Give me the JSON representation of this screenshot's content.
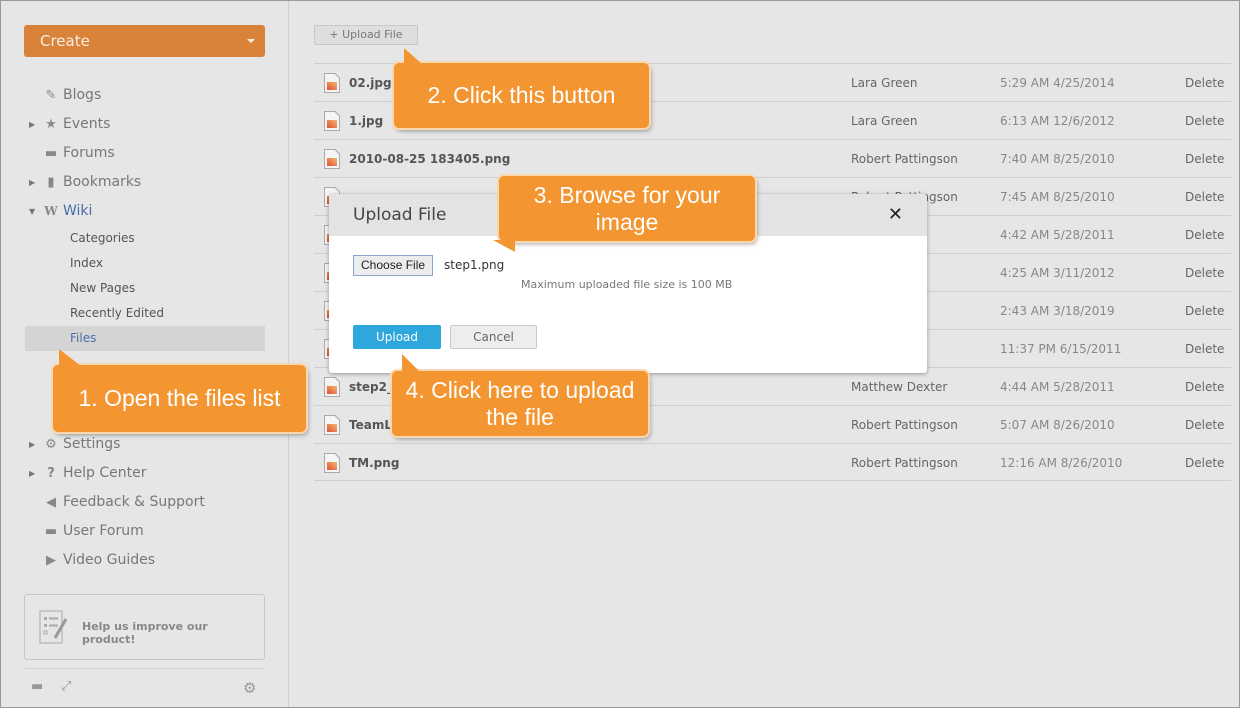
{
  "sidebar": {
    "create_label": "Create",
    "nav": [
      {
        "label": "Blogs",
        "icon": "edit-icon"
      },
      {
        "label": "Events",
        "icon": "pin-icon",
        "expandable": true
      },
      {
        "label": "Forums",
        "icon": "chat-bubble-icon"
      },
      {
        "label": "Bookmarks",
        "icon": "bookmark-icon",
        "expandable": true
      },
      {
        "label": "Wiki",
        "icon": "wiki-icon",
        "expanded": true
      }
    ],
    "wiki_sub": [
      "Categories",
      "Index",
      "New Pages",
      "Recently Edited",
      "Files"
    ],
    "nav_bottom": [
      {
        "label": "Settings",
        "icon": "gear-icon",
        "expandable": true
      },
      {
        "label": "Help Center",
        "icon": "question-icon",
        "expandable": true
      },
      {
        "label": "Feedback & Support",
        "icon": "megaphone-icon"
      },
      {
        "label": "User Forum",
        "icon": "comment-icon"
      },
      {
        "label": "Video Guides",
        "icon": "video-icon"
      }
    ],
    "help_box_label": "Help us improve our product!"
  },
  "main": {
    "upload_button_label": "+ Upload File",
    "files": [
      {
        "name": "02.jpg",
        "user": "Lara Green",
        "date": "5:29 AM 4/25/2014",
        "action": "Delete"
      },
      {
        "name": "1.jpg",
        "user": "Lara Green",
        "date": "6:13 AM 12/6/2012",
        "action": "Delete"
      },
      {
        "name": "2010-08-25 183405.png",
        "user": "Robert Pattingson",
        "date": "7:40 AM 8/25/2010",
        "action": "Delete"
      },
      {
        "name": "",
        "user": "Robert Pattingson",
        "date": "7:45 AM 8/25/2010",
        "action": "Delete"
      },
      {
        "name": "",
        "user": "",
        "date": "4:42 AM 5/28/2011",
        "action": "Delete"
      },
      {
        "name": "",
        "user": "",
        "date": "4:25 AM 3/11/2012",
        "action": "Delete"
      },
      {
        "name": "",
        "user": "",
        "date": "2:43 AM 3/18/2019",
        "action": "Delete"
      },
      {
        "name": "",
        "user": "",
        "date": "11:37 PM 6/15/2011",
        "action": "Delete"
      },
      {
        "name": "step2_",
        "user": "Matthew Dexter",
        "date": "4:44 AM 5/28/2011",
        "action": "Delete"
      },
      {
        "name": "TeamL",
        "user": "Robert Pattingson",
        "date": "5:07 AM 8/26/2010",
        "action": "Delete"
      },
      {
        "name": "TM.png",
        "user": "Robert Pattingson",
        "date": "12:16 AM 8/26/2010",
        "action": "Delete"
      }
    ]
  },
  "modal": {
    "title": "Upload File",
    "close_glyph": "✕",
    "choose_file_label": "Choose File",
    "chosen_file": "step1.png",
    "max_size_note": "Maximum uploaded file size is 100 MB",
    "upload_label": "Upload",
    "cancel_label": "Cancel"
  },
  "callouts": {
    "step1": "1. Open the files list",
    "step2": "2. Click this button",
    "step3_line1": "3. Browse for your",
    "step3_line2": "image",
    "step4_line1": "4. Click here to upload",
    "step4_line2": "the file"
  },
  "colors": {
    "create_button": "#d9823a",
    "callout": "#f39530",
    "upload_primary": "#2ea7dc",
    "active_link": "#4a6ea8"
  }
}
